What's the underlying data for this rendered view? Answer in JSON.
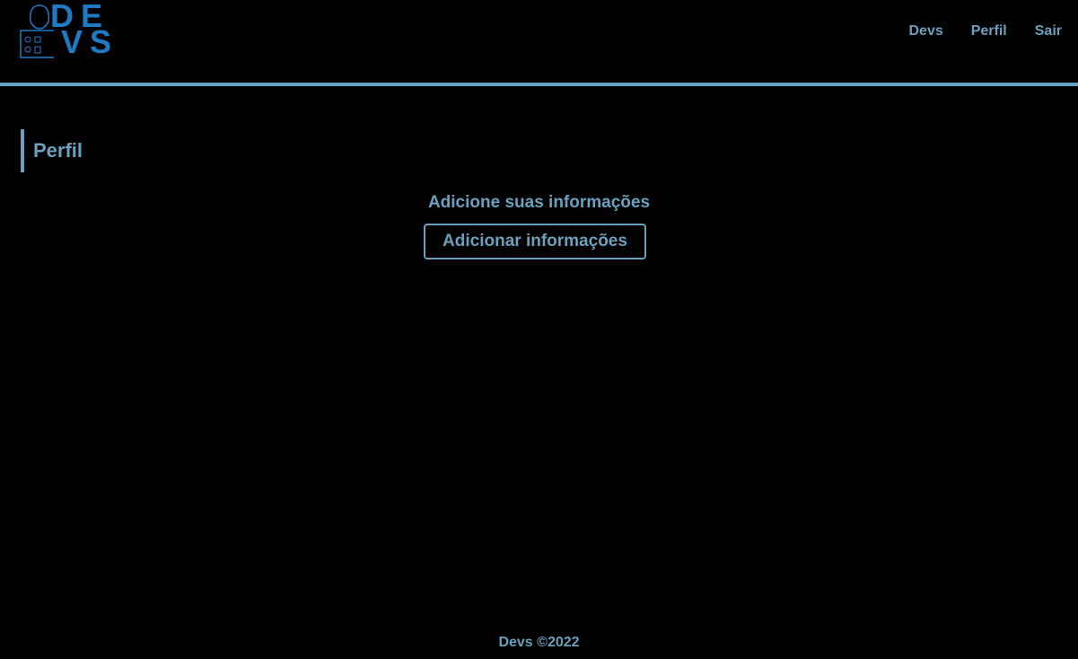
{
  "logo": {
    "text_top": "DE",
    "text_bottom": "VS",
    "icon": "developer-avatar-icon"
  },
  "nav": {
    "items": [
      {
        "label": "Devs"
      },
      {
        "label": "Perfil"
      },
      {
        "label": "Sair"
      }
    ]
  },
  "page": {
    "title": "Perfil",
    "subtitle": "Adicione suas informações",
    "add_button": "Adicionar informações"
  },
  "footer": {
    "text": "Devs ©2022"
  },
  "colors": {
    "accent": "#6aa0bd",
    "logo": "#1f7ac4",
    "background": "#000000"
  }
}
